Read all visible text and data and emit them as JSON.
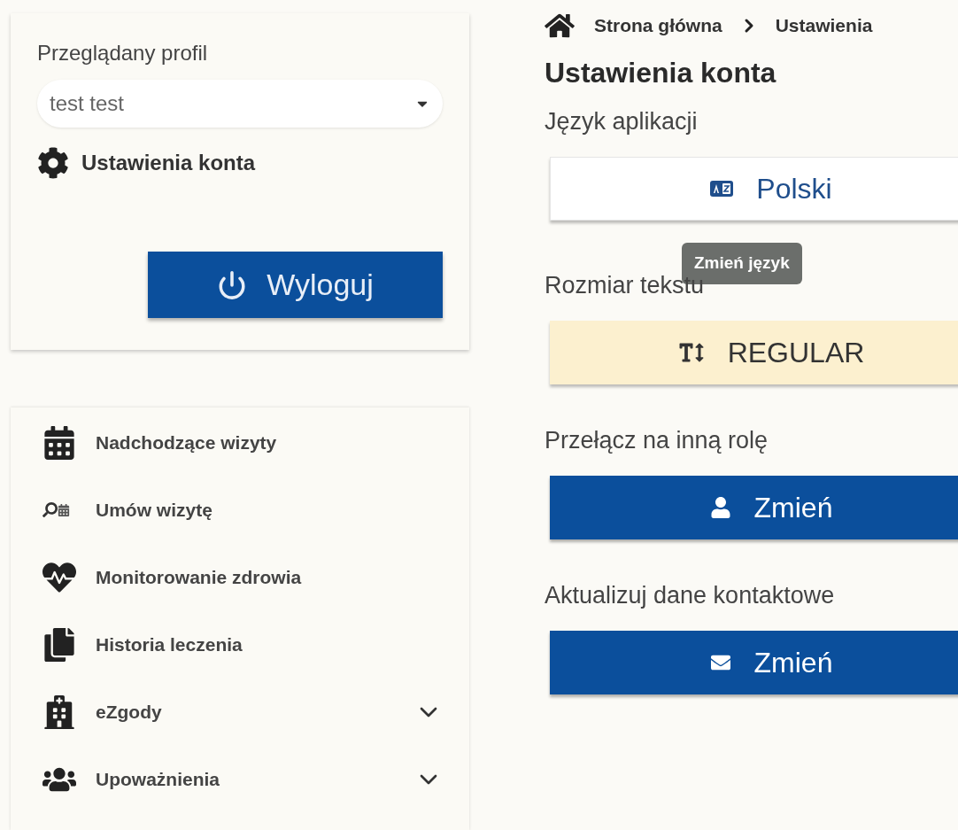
{
  "profile_card": {
    "label": "Przeglądany profil",
    "profile_select": {
      "value": "test test"
    },
    "settings_link": "Ustawienia konta",
    "logout_button": "Wyloguj"
  },
  "menu": [
    {
      "label": "Nadchodzące wizyty",
      "kind": "link"
    },
    {
      "label": "Umów wizytę",
      "kind": "link"
    },
    {
      "label": "Monitorowanie zdrowia",
      "kind": "link"
    },
    {
      "label": "Historia leczenia",
      "kind": "link"
    },
    {
      "label": "eZgody",
      "kind": "group",
      "expanded": false
    },
    {
      "label": "Upoważnienia",
      "kind": "group",
      "expanded": false
    }
  ],
  "breadcrumb": [
    "Strona główna",
    "Ustawienia"
  ],
  "title": "Ustawienia konta",
  "sections": [
    {
      "label": "Język aplikacji",
      "button": "Polski",
      "kind": "outline",
      "tooltip": "Zmień język"
    },
    {
      "label": "Rozmiar tekstu",
      "button": "REGULAR",
      "kind": "warning"
    },
    {
      "label": "Przełącz na inną rolę",
      "button": "Zmień",
      "kind": "primary"
    },
    {
      "label": "Aktualizuj dane kontaktowe",
      "button": "Zmień",
      "kind": "primary"
    }
  ]
}
